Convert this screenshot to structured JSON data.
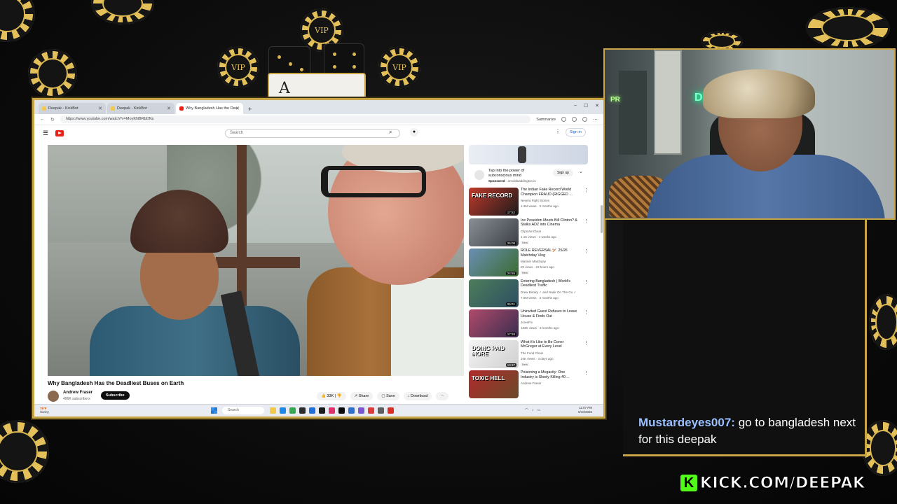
{
  "browser": {
    "tabs": [
      {
        "label": "Deepak - KickBot"
      },
      {
        "label": "Deepak - KickBot"
      },
      {
        "label": "Why Bangladesh Has the Dea",
        "active": true
      }
    ],
    "new_tab": "+",
    "url": "https://www.youtube.com/watch?v=MoyKNBRbDNs",
    "summarize": "Summarize",
    "window_controls": [
      "–",
      "☐",
      "✕"
    ]
  },
  "youtube": {
    "search_placeholder": "Search",
    "sign_in": "Sign in",
    "video_title": "Why Bangladesh Has the Deadliest Buses on Earth",
    "channel_name": "Andrew Fraser",
    "channel_subs": "496K subscribers",
    "subscribe": "Subscribe",
    "likes": "33K",
    "share": "Share",
    "save": "Save",
    "download": "Download",
    "more": "···"
  },
  "ad": {
    "title": "Tap into the power of subconscious mind",
    "sponsored": "Sponsored",
    "domain": "· arnoldwaddington.in",
    "cta": "Sign up"
  },
  "recommendations": [
    {
      "title": "The Indian Fake Record World Champion FRAUD (RIGGED ...",
      "channel": "Nevera Fight Stories",
      "meta": "1.3M views · 3 months ago",
      "duration": "17:52",
      "badge": "",
      "thumb_colors": [
        "#c0392b",
        "#1b1b1b"
      ],
      "thumb_text": "FAKE RECORD"
    },
    {
      "title": "Ice Poseidon Meets Bill Clinton? & Stalks ADZ into Cinema",
      "channel": "ClipsVonClaus",
      "meta": "1.1K views · 4 weeks ago",
      "duration": "25:08",
      "badge": "New",
      "thumb_colors": [
        "#8a8f96",
        "#3b3f45"
      ],
      "thumb_text": ""
    },
    {
      "title": "ROLE REVERSAL 🏏 25/26 Matchday Vlog",
      "channel": "Mariner Matchday",
      "meta": "20 views · 23 hours ago",
      "duration": "24:55",
      "badge": "New",
      "thumb_colors": [
        "#6a8fb5",
        "#3a6b2f"
      ],
      "thumb_text": ""
    },
    {
      "title": "Entering Bangladesh | World's Deadliest Traffic",
      "channel": "Drew Binsky ✓ and Nadir On The Go ✓",
      "meta": "7.6M views · 3 months ago",
      "duration": "26:01",
      "badge": "",
      "thumb_colors": [
        "#4c7d5a",
        "#2e4f63"
      ],
      "thumb_text": ""
    },
    {
      "title": "Uninvited Guest Refuses to Leave House & Finds Out",
      "channel": "JoresFix",
      "meta": "183K views · 3 months ago",
      "duration": "17:28",
      "badge": "",
      "thumb_colors": [
        "#b04a6a",
        "#3a2d4f"
      ],
      "thumb_text": ""
    },
    {
      "title": "What It's Like to Be Conor McGregor at Every Level",
      "channel": "The Food Chain",
      "meta": "10K views · 3 days ago",
      "duration": "10:37",
      "badge": "New",
      "thumb_colors": [
        "#f4f4f4",
        "#cfcfcf"
      ],
      "thumb_text": "DOING PAID MORE"
    },
    {
      "title": "Poisoning a Megacity: One Industry is Slowly Killing 40 ...",
      "channel": "Andrew Fraser",
      "meta": "",
      "duration": "",
      "badge": "",
      "thumb_colors": [
        "#b02a2a",
        "#6b4a2a"
      ],
      "thumb_text": "TOXIC HELL"
    }
  ],
  "taskbar": {
    "weather": "75°F",
    "weather_desc": "Sunny",
    "search": "Search",
    "time": "11:07 PM",
    "date": "5/10/2026",
    "app_colors": [
      "#f2c94c",
      "#1e88e5",
      "#34a853",
      "#2b2b2b",
      "#1e6fd9",
      "#1b1b1b",
      "#e1306c",
      "#0a0a0a",
      "#2f6fd0",
      "#7a57d1",
      "#dd3b3b",
      "#5e5e5e",
      "#d93025"
    ]
  },
  "overlay": {
    "chip_label": "VIP",
    "card_label": "A"
  },
  "webcam": {
    "neon_main": "DEEP",
    "neon_small": "PR"
  },
  "chat": {
    "username": "Mustardeyes007:",
    "message": "go to bangladesh next for this deepak"
  },
  "kick": {
    "logo_letter": "K",
    "url": "KICK.COM/DEEPAK"
  },
  "colors": {
    "gold": "#c9a545",
    "kick_green": "#53fc18",
    "youtube_red": "#e62117",
    "chat_username": "#9bc0ff"
  }
}
